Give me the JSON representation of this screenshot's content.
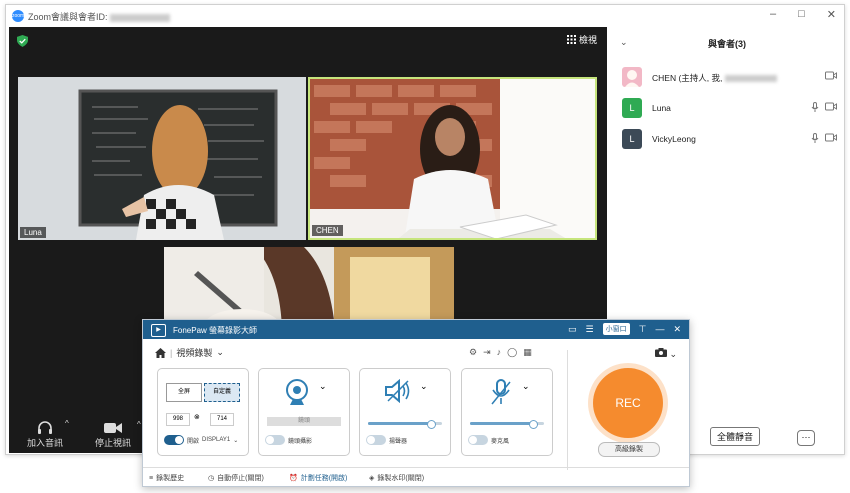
{
  "zoom": {
    "title": "Zoom會議與會者ID:",
    "window_controls": [
      "–",
      "□",
      "✕"
    ],
    "view_label": "檢視",
    "controls": {
      "audio_label": "加入音訊",
      "video_label": "停止視訊"
    },
    "tiles": {
      "luna_label": "Luna",
      "chen_label": "CHEN"
    }
  },
  "participants": {
    "title": "與會者(3)",
    "items": [
      {
        "name": "CHEN (主持人, 我,",
        "initial": "",
        "color": "#f2b8c6"
      },
      {
        "name": "Luna",
        "initial": "L",
        "color": "#2faa53"
      },
      {
        "name": "VickyLeong",
        "initial": "L",
        "color": "#3c4a57"
      }
    ],
    "mute_all": "全體靜音",
    "more": "···"
  },
  "fonepaw": {
    "title": "FonePaw 螢幕錄影大師",
    "mini_label": "小窗口",
    "mode_label": "視頻錄製",
    "screen": {
      "full": "全屏",
      "custom": "自定義",
      "width": "998",
      "height": "714",
      "toggle": "開啟",
      "display": "DISPLAY1"
    },
    "webcam": {
      "label": "鏡頭",
      "toggle_label": "鏡頭攝影"
    },
    "system_sound": {
      "label": "揚聲器",
      "level": 0.85
    },
    "microphone": {
      "label": "麥克風",
      "level": 0.85
    },
    "rec_label": "REC",
    "advanced_label": "高級錄製",
    "footer": [
      "錄製歷史",
      "自動停止(關閉)",
      "計劃任務(開啟)",
      "錄製水印(關閉)"
    ]
  },
  "colors": {
    "accent": "#1f5f8e",
    "rec": "#f58b2e",
    "active_speaker": "#c6e57d"
  }
}
